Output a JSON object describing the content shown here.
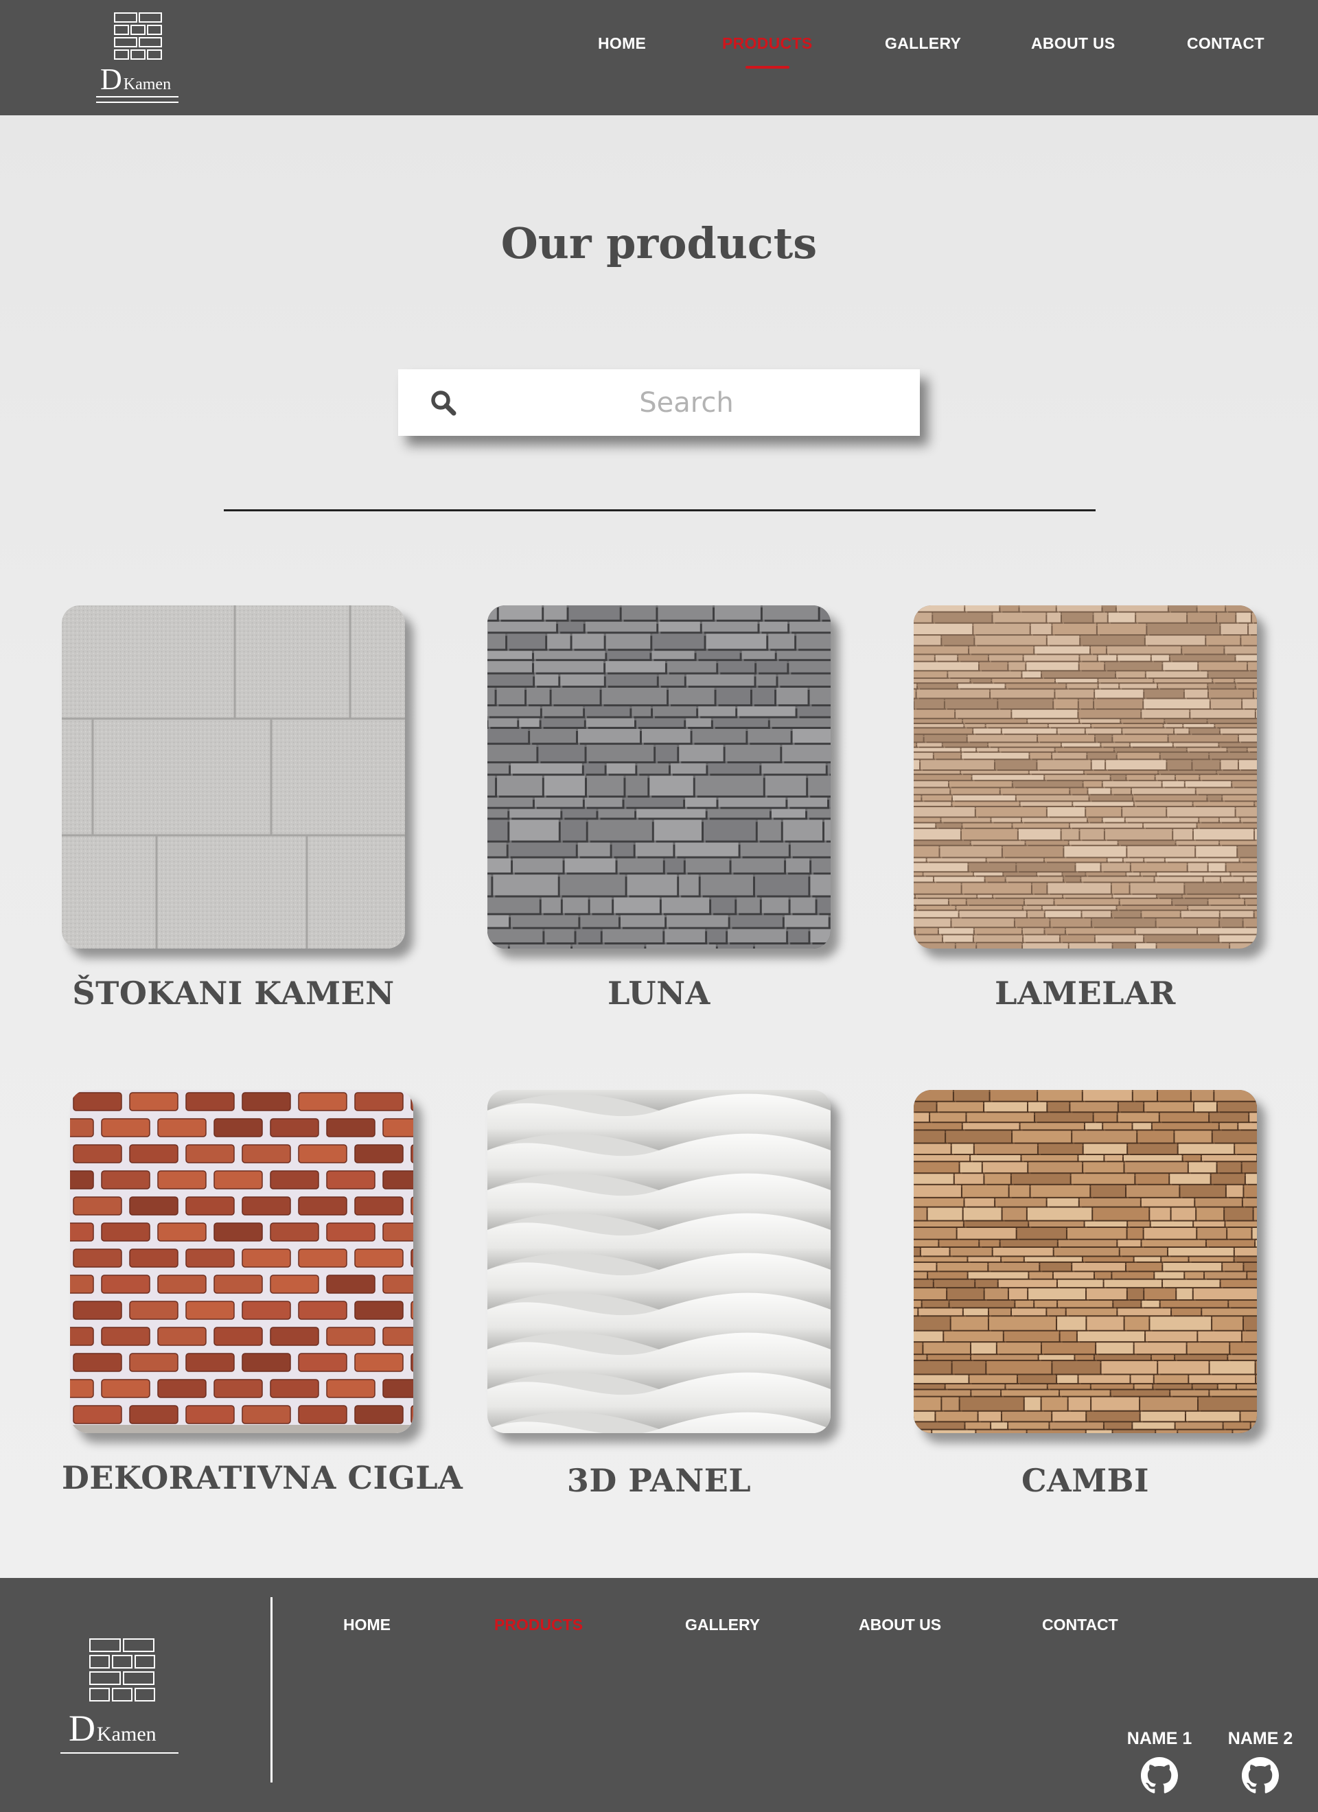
{
  "header": {
    "logo": {
      "letter": "D",
      "word": "Kamen"
    },
    "nav": [
      {
        "label": "HOME",
        "active": false
      },
      {
        "label": "PRODUCTS",
        "active": true
      },
      {
        "label": "GALLERY",
        "active": false
      },
      {
        "label": "ABOUT US",
        "active": false
      },
      {
        "label": "CONTACT",
        "active": false
      }
    ]
  },
  "main": {
    "title": "Our products",
    "search": {
      "placeholder": "Search",
      "value": "",
      "icon": "search-icon"
    },
    "products": [
      {
        "name": "ŠTOKANI KAMEN",
        "texture": "light-grey-stone-blocks"
      },
      {
        "name": "LUNA",
        "texture": "dark-grey-slate-strips"
      },
      {
        "name": "LAMELAR",
        "texture": "beige-stacked-stone"
      },
      {
        "name": "DEKORATIVNA CIGLA",
        "texture": "red-brick"
      },
      {
        "name": "3D PANEL",
        "texture": "white-wave-panel"
      },
      {
        "name": "CAMBI",
        "texture": "brown-stacked-stone"
      }
    ]
  },
  "footer": {
    "logo": {
      "letter": "D",
      "word": "Kamen"
    },
    "nav": [
      {
        "label": "HOME",
        "active": false
      },
      {
        "label": "PRODUCTS",
        "active": true
      },
      {
        "label": "GALLERY",
        "active": false
      },
      {
        "label": "ABOUT US",
        "active": false
      },
      {
        "label": "CONTACT",
        "active": false
      }
    ],
    "authors": [
      {
        "name": "NAME 1",
        "icon": "github-icon"
      },
      {
        "name": "NAME 2",
        "icon": "github-icon"
      }
    ]
  },
  "colors": {
    "bar": "#525252",
    "accent": "#d0151c",
    "text_dark": "#4d4d4d",
    "background": "#e9e9e9"
  }
}
